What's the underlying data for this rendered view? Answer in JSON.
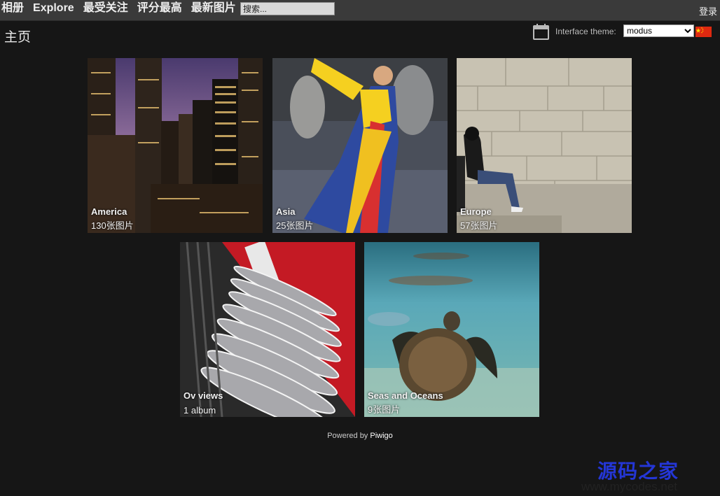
{
  "nav": {
    "items": [
      "相册",
      "Explore",
      "最受关注",
      "评分最高",
      "最新图片"
    ],
    "search_placeholder": "搜索...",
    "login": "登录"
  },
  "page": {
    "title": "主页",
    "theme_label": "Interface theme:",
    "theme_value": "modus",
    "theme_options": [
      "modus"
    ]
  },
  "albums": [
    {
      "name": "America",
      "count": "130张图片",
      "icon": "city-skyline-photo"
    },
    {
      "name": "Asia",
      "count": "25张图片",
      "icon": "dancer-photo"
    },
    {
      "name": "Europe",
      "count": "57张图片",
      "icon": "stone-wall-photo"
    },
    {
      "name": "Ov  views",
      "count": "1 album",
      "icon": "metal-sculpture-photo"
    },
    {
      "name": "Seas and Oceans",
      "count": "9张图片",
      "icon": "sea-turtle-photo"
    }
  ],
  "footer": {
    "powered_by": "Powered by",
    "brand": "Piwigo"
  },
  "watermark": {
    "chinese": "源码之家",
    "url": "www.mycodes.net"
  },
  "colors": {
    "background": "#161616",
    "topbar": "#3a3a3a",
    "watermark_blue": "#2436d6"
  }
}
